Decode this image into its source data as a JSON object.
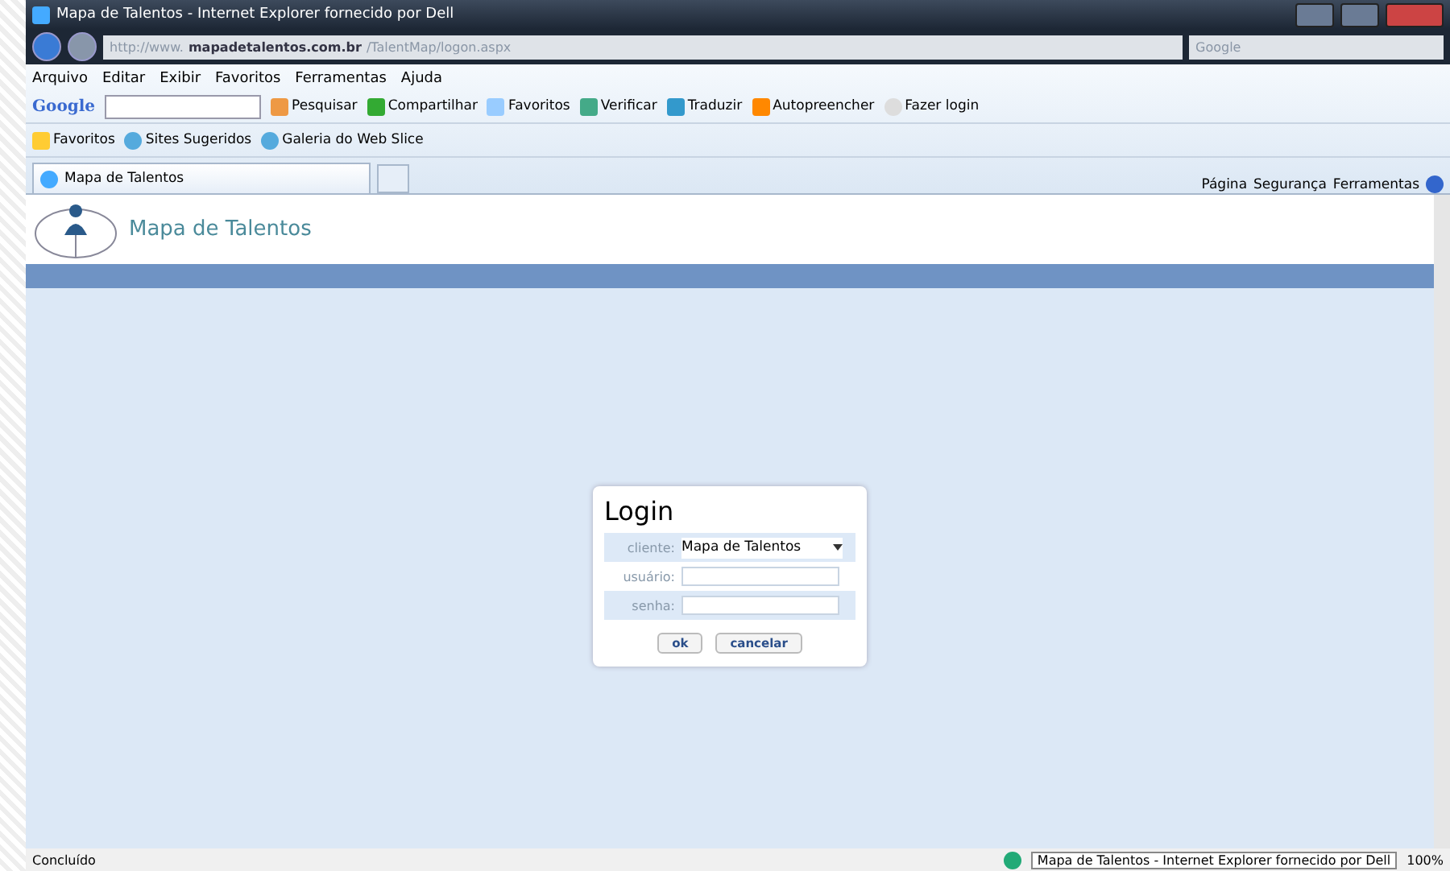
{
  "window": {
    "title": "Mapa de Talentos - Internet Explorer fornecido por Dell"
  },
  "address_bar": {
    "url_prefix": "http://www.",
    "url_domain": "mapadetalentos.com.br",
    "url_path": "/TalentMap/logon.aspx",
    "search_placeholder": "Google"
  },
  "menu": [
    "Arquivo",
    "Editar",
    "Exibir",
    "Favoritos",
    "Ferramentas",
    "Ajuda"
  ],
  "google_toolbar": {
    "logo": "Google",
    "buttons": [
      {
        "label": "Pesquisar",
        "kind": "search"
      },
      {
        "label": "Compartilhar",
        "kind": "share"
      },
      {
        "label": "Favoritos",
        "kind": "star"
      },
      {
        "label": "Verificar",
        "kind": "check"
      },
      {
        "label": "Traduzir",
        "kind": "translate"
      },
      {
        "label": "Autopreencher",
        "kind": "fill"
      },
      {
        "label": "Fazer login",
        "kind": "login"
      }
    ]
  },
  "favorites_bar": {
    "label": "Favoritos",
    "items": [
      "Sites Sugeridos",
      "Galeria do Web Slice"
    ]
  },
  "tabs": [
    {
      "label": "Mapa de Talentos",
      "selected": true
    }
  ],
  "command_bar": [
    "Página",
    "Segurança",
    "Ferramentas"
  ],
  "page": {
    "brand": "Mapa de Talentos",
    "login": {
      "title": "Login",
      "fields": [
        {
          "label": "cliente:",
          "kind": "select",
          "value": "Mapa de Talentos"
        },
        {
          "label": "usuário:",
          "kind": "text"
        },
        {
          "label": "senha:",
          "kind": "password"
        }
      ],
      "buttons": [
        "ok",
        "cancelar"
      ]
    }
  },
  "status_bar": {
    "text": "Concluído",
    "tooltip": "Mapa de Talentos - Internet Explorer fornecido por Dell",
    "zoom": "100%"
  }
}
